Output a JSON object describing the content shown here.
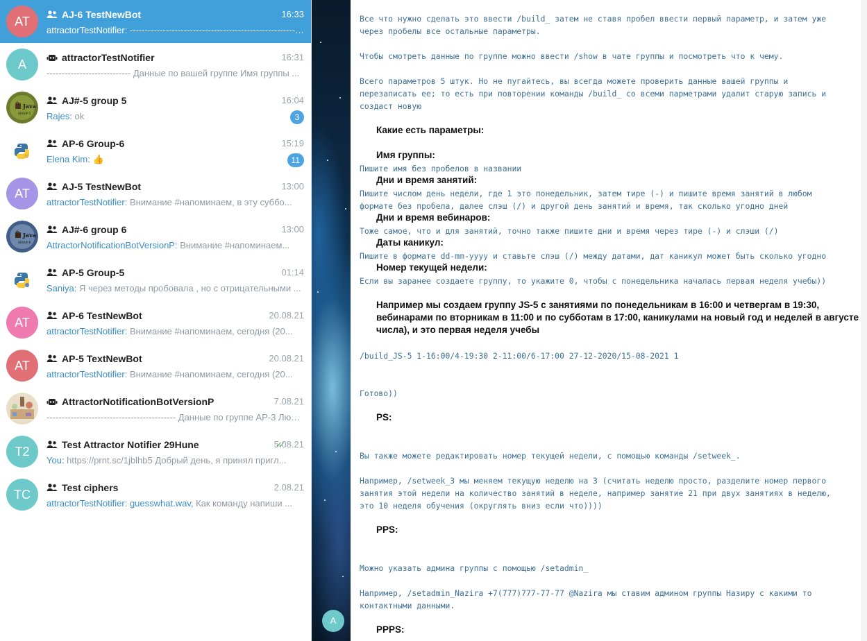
{
  "chats": [
    {
      "title": "AJ-6 TestNewBot",
      "kind": "group",
      "time": "16:33",
      "sender": "attractorTestNotifier: ",
      "preview": "------------------------------------------------------------",
      "avatar_text": "AT",
      "avatar_color": "#e17076",
      "active": true
    },
    {
      "title": "attractorTestNotifier",
      "kind": "bot",
      "time": "16:31",
      "sender": "",
      "preview": "----------------------------  Данные по вашей группе  Имя группы ...",
      "avatar_text": "A",
      "avatar_color": "#6ec9cb"
    },
    {
      "title": "AJ#-5 group 5",
      "kind": "group",
      "time": "16:04",
      "sender": "Rajes: ",
      "preview": "ok",
      "avatar_text": "",
      "avatar_icon": "java-logo-icon",
      "badge": "3"
    },
    {
      "title": "AP-6 Group-6",
      "kind": "group",
      "time": "15:19",
      "sender": "Elena Kim: ",
      "preview": "👍",
      "avatar_text": "",
      "avatar_icon": "python-logo-icon",
      "badge": "11"
    },
    {
      "title": "AJ-5 TestNewBot",
      "kind": "group",
      "time": "13:00",
      "sender": "attractorTestNotifier: ",
      "preview": "Внимание #напоминаем, в эту суббо...",
      "avatar_text": "AT",
      "avatar_color": "#a695e7"
    },
    {
      "title": "AJ#-6 group 6",
      "kind": "group",
      "time": "13:00",
      "sender": "AttractorNotificationBotVersionP: ",
      "preview": "Внимание #напоминаем...",
      "avatar_text": "",
      "avatar_icon": "java-logo-icon"
    },
    {
      "title": "AP-5 Group-5",
      "kind": "group",
      "time": "01:14",
      "sender": "Saniya: ",
      "preview": "Я через методы пробовала , но с отрицательными ...",
      "avatar_text": "",
      "avatar_icon": "python-logo-icon"
    },
    {
      "title": "AP-6 TestNewBot",
      "kind": "group",
      "time": "20.08.21",
      "sender": "attractorTestNotifier: ",
      "preview": "Внимание #напоминаем, сегодня (20...",
      "avatar_text": "AT",
      "avatar_color": "#ee7aae"
    },
    {
      "title": "AP-5 TextNewBot",
      "kind": "group",
      "time": "20.08.21",
      "sender": "attractorTestNotifier: ",
      "preview": "Внимание #напоминаем, сегодня (20...",
      "avatar_text": "AT",
      "avatar_color": "#e17076"
    },
    {
      "title": "AttractorNotificationBotVersionP",
      "kind": "bot",
      "time": "7.08.21",
      "sender": "",
      "preview": "-------------------------------------------  Данные по группе  AP-3  Людей ...",
      "avatar_text": "",
      "avatar_icon": "illustration-avatar-icon"
    },
    {
      "title": "Test Attractor Notifier 29Hune",
      "kind": "group",
      "time": "5.08.21",
      "read": true,
      "sender": "You: ",
      "preview": "https://prnt.sc/1jblhb5   Добрый день, я принял пригл...",
      "avatar_text": "T2",
      "avatar_color": "#6ec9cb"
    },
    {
      "title": "Test ciphers",
      "kind": "group",
      "time": "2.08.21",
      "sender": "attractorTestNotifier: ",
      "sender_extra": "guesswhat.wav, ",
      "preview": "Как команду напиши ...",
      "avatar_text": "TC",
      "avatar_color": "#6ec9cb"
    }
  ],
  "bottom_avatar": "A",
  "message_lines": [
    {
      "style": "mono",
      "text": "Все что нужно сделать это ввести /build_ затем не ставя пробел ввести первый параметр, и затем уже"
    },
    {
      "style": "mono",
      "text": "через пробелы все остальные параметры."
    },
    {
      "style": "mono",
      "text": "Чтобы смотреть данные по группе можно ввести /show в чате группы и посмотреть что к чему."
    },
    {
      "style": "mono",
      "text": "Всего параметров 5 штук. Но не пугайтесь, вы всегда можете проверить данные вашей группы и"
    },
    {
      "style": "mono",
      "text": "перезаписать ее; то есть при повторении команды /build_ со всеми парметрами удалит старую запись и"
    },
    {
      "style": "mono",
      "text": "создаст новую"
    },
    {
      "style": "bold",
      "text": "Какие есть параметры:"
    },
    {
      "style": "bold",
      "text": "Имя группы:"
    },
    {
      "style": "mono",
      "text": "Пишите имя без пробелов в названии"
    },
    {
      "style": "bold",
      "text": "Дни и время занятий:"
    },
    {
      "style": "mono",
      "text": "Пишите числом день недели, где 1 это понедельник, затем тире (-) и пишите время занятий в любом"
    },
    {
      "style": "mono",
      "text": "формате без пробела, далее слэш (/) и другой день занятий и время, так сколько угодно дней"
    },
    {
      "style": "bold",
      "text": "Дни и время вебинаров:"
    },
    {
      "style": "mono",
      "text": "Тоже самое, что и для занятий, точно также пишите дни и время через тире (-) и слэши (/)"
    },
    {
      "style": "bold",
      "text": "Даты каникул:"
    },
    {
      "style": "mono",
      "text": "Пишите в формате dd-mm-yyyy и ставьте слэш (/) между датами, дат каникул может быть сколько угодно"
    },
    {
      "style": "bold",
      "text": "Номер текущей недели:"
    },
    {
      "style": "mono",
      "text": "Если вы заранее создаете группу, то укажите 0, чтобы с понедельника началась первая неделя учебы))"
    },
    {
      "style": "bold",
      "text": "Например мы создаем группу JS-5 с занятиями по понедельникам в 16:00 и четвергам в 19:30,"
    },
    {
      "style": "bold",
      "text": "вебинарами по вторникам в 11:00 и по субботам в 17:00, каникулами на новый год и неделей в августе (15"
    },
    {
      "style": "bold",
      "text": "числа), и это первая неделя учебы"
    },
    {
      "style": "mono",
      "text": "/build_JS-5 1-16:00/4-19:30 2-11:00/6-17:00 27-12-2020/15-08-2021 1"
    },
    {
      "style": "mono",
      "text": "Готово))"
    },
    {
      "style": "bold",
      "text": "PS:"
    },
    {
      "style": "mono",
      "text": "Вы также можете редактировать номер текущей недели, с помощью команды /setweek_."
    },
    {
      "style": "mono",
      "text": "Например, /setweek_3 мы меняем текущую неделю на 3 (считать неделю просто, разделите номер первого"
    },
    {
      "style": "mono",
      "text": "занятия этой недели на количество занятий в неделе, например занятие 21 при двух занятиях в неделю,"
    },
    {
      "style": "mono",
      "text": "это 10 неделя обучения (округлять вниз если что))))"
    },
    {
      "style": "bold",
      "text": "PPS:"
    },
    {
      "style": "mono",
      "text": "Можно указать админа группы с помощью /setadmin_"
    },
    {
      "style": "mono",
      "text": "Например, /setadmin_Nazira +7(777)777-77-77 @Nazira мы ставим админом группы Назиру с какими то"
    },
    {
      "style": "mono",
      "text": "контактными данными."
    },
    {
      "style": "bold",
      "text": "PPPS:"
    }
  ]
}
